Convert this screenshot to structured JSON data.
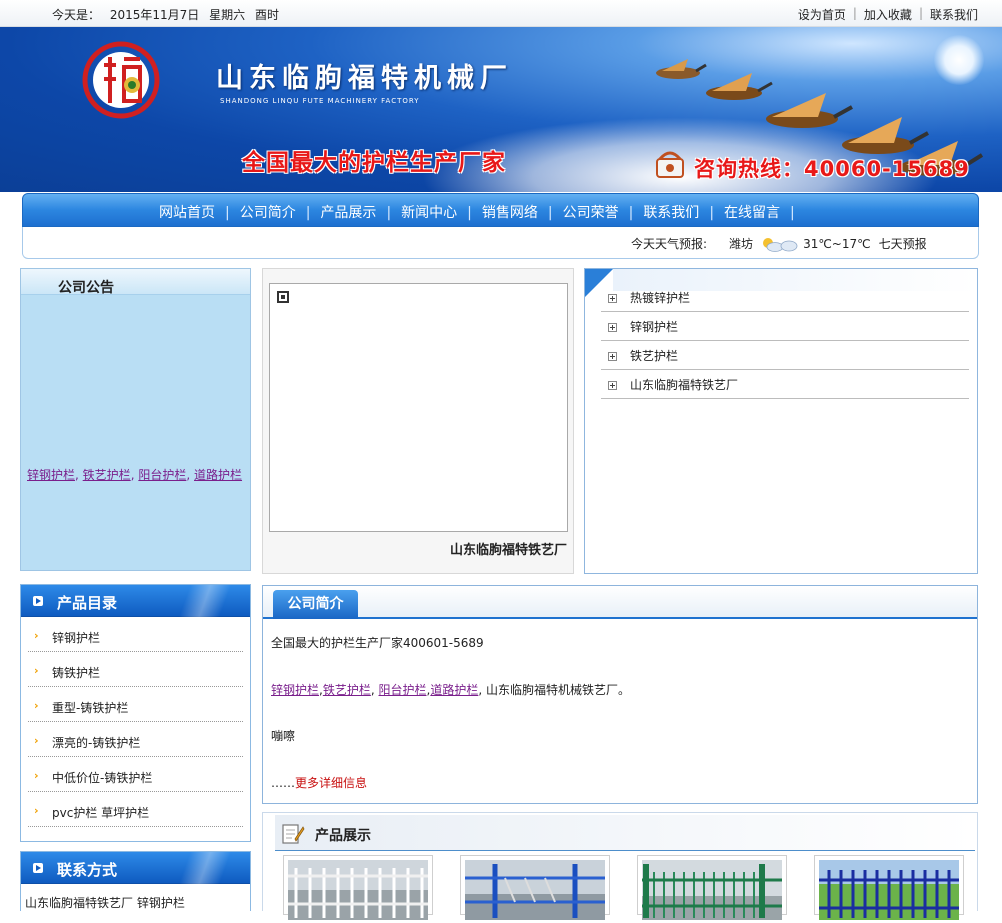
{
  "topbar": {
    "date_label": "今天是：",
    "date_value": "2015年11月7日",
    "weekday": "星期六",
    "time_label": "酉时",
    "links": [
      "设为首页",
      "加入收藏",
      "联系我们"
    ]
  },
  "banner": {
    "company_name": "山东临朐福特机械厂",
    "company_name_en": "SHANDONG LINQU FUTE MACHINERY FACTORY",
    "slogan": "全国最大的护栏生产厂家",
    "hotline": "咨询热线：40060-15689"
  },
  "nav": {
    "items": [
      "网站首页",
      "公司简介",
      "产品展示",
      "新闻中心",
      "销售网络",
      "公司荣誉",
      "联系我们",
      "在线留言"
    ]
  },
  "weather": {
    "label": "今天天气预报:",
    "city": "潍坊",
    "temp": "31℃~17℃",
    "forecast_link": "七天预报"
  },
  "notice": {
    "title": "公司公告",
    "links": [
      "锌钢护栏",
      "铁艺护栏",
      "阳台护栏",
      "道路护栏"
    ]
  },
  "photo": {
    "caption": "山东临朐福特铁艺厂"
  },
  "categories": {
    "items": [
      "热镀锌护栏",
      "锌钢护栏",
      "铁艺护栏",
      "山东临朐福特铁艺厂"
    ]
  },
  "product_catalog": {
    "title": "产品目录",
    "items": [
      "锌钢护栏",
      "铸铁护栏",
      "重型-铸铁护栏",
      "漂亮的-铸铁护栏",
      "中低价位-铸铁护栏",
      "pvc护栏 草坪护栏"
    ]
  },
  "contact": {
    "title": "联系方式",
    "text": "山东临朐福特铁艺厂 锌钢护栏"
  },
  "about": {
    "tab": "公司简介",
    "line1": "全国最大的护栏生产厂家400601-5689",
    "line2_links": [
      "锌钢护栏",
      "铁艺护栏",
      "阳台护栏",
      "道路护栏"
    ],
    "line2_tail": "山东临朐福特机械铁艺厂。",
    "line3": "嘣嚓",
    "more_prefix": "……",
    "more_link": "更多详细信息"
  },
  "products": {
    "title": "产品展示"
  },
  "colors": {
    "nav_blue": "#2c86e0",
    "link_purple": "#7a1f8c",
    "slogan_red": "#e81818"
  }
}
